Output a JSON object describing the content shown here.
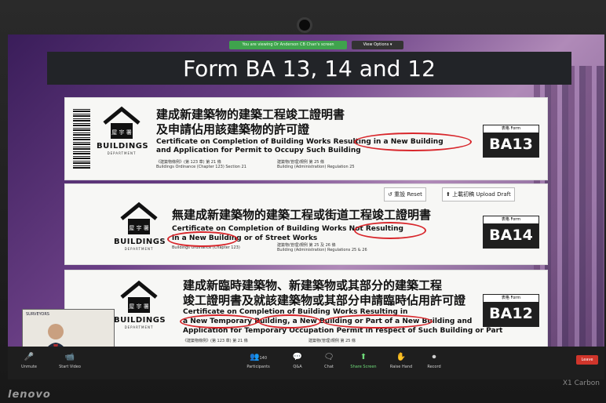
{
  "zoom": {
    "share_notice": "You are viewing Dr Anderson CB Chan's screen",
    "view_options": "View Options ▾",
    "participants_count": "140",
    "toolbar": [
      {
        "icon": "microphone-icon",
        "label": "Unmute"
      },
      {
        "icon": "video-icon",
        "label": "Start Video"
      },
      {
        "icon": "participants-icon",
        "label": "Participants"
      },
      {
        "icon": "qa-icon",
        "label": "Q&A"
      },
      {
        "icon": "chat-icon",
        "label": "Chat"
      },
      {
        "icon": "share-screen-icon",
        "label": "Share Screen"
      },
      {
        "icon": "raise-hand-icon",
        "label": "Raise Hand"
      },
      {
        "icon": "record-icon",
        "label": "Record"
      }
    ],
    "leave_label": "Leave",
    "speaker_name": "Dr Anderson CB Chan",
    "speaker_org": "SURVEYORS"
  },
  "slide": {
    "title": "Form BA 13, 14 and 12",
    "logo_text": "BUILDINGS",
    "logo_sub": "DEPARTMENT",
    "logo_cn": "屋 宇 署",
    "forms": [
      {
        "cn_line1": "建成新建築物的建築工程竣工證明書",
        "cn_line2": "及申請佔用該建築物的許可證",
        "en_line1": "Certificate on Completion of Building Works Resulting in a New Building",
        "en_line2": "and Application for Permit to Occupy Such Building",
        "ref_cn_left": "《建築物條例》(第 123 章) 第 21 條",
        "ref_en_left": "Buildings Ordinance (Chapter 123) Section 21",
        "ref_cn_right": "建築物(管理)規例 第 25 條",
        "ref_en_right": "Building (Administration) Regulation 25",
        "badge_label": "表格 Form",
        "code": "BA13"
      },
      {
        "cn_line1": "無建成新建築物的建築工程或街道工程竣工證明書",
        "en_line1": "Certificate on Completion of Building Works Not Resulting",
        "en_line2": "in a New Building or of Street Works",
        "ref_cn_left": "《建築物條例》(第 123 章)",
        "ref_en_left": "Buildings Ordinance (Chapter 123)",
        "ref_cn_right": "建築物(管理)規例 第 25 及 26 條",
        "ref_en_right": "Building (Administration) Regulations 25 & 26",
        "badge_label": "表格 Form",
        "code": "BA14",
        "reset_label": "重設 Reset",
        "upload_label": "上載初稿 Upload Draft"
      },
      {
        "cn_line1": "建成新臨時建築物、新建築物或其部分的建築工程",
        "cn_line2": "竣工證明書及就該建築物或其部分申請臨時佔用許可證",
        "en_line1": "Certificate on Completion of Building Works Resulting in",
        "en_line2": "a New Temporary Building, a New Building or Part of a New Building and",
        "en_line3": "Application for Temporary Occupation Permit in respect of Such Building or Part",
        "ref_cn_left": "《建築物條例》(第 123 章) 第 21 條",
        "ref_cn_right": "建築物(管理)規例 第 25 條",
        "badge_label": "表格 Form",
        "code": "BA12"
      }
    ]
  },
  "device": {
    "brand": "lenovo",
    "model": "X1 Carbon"
  }
}
